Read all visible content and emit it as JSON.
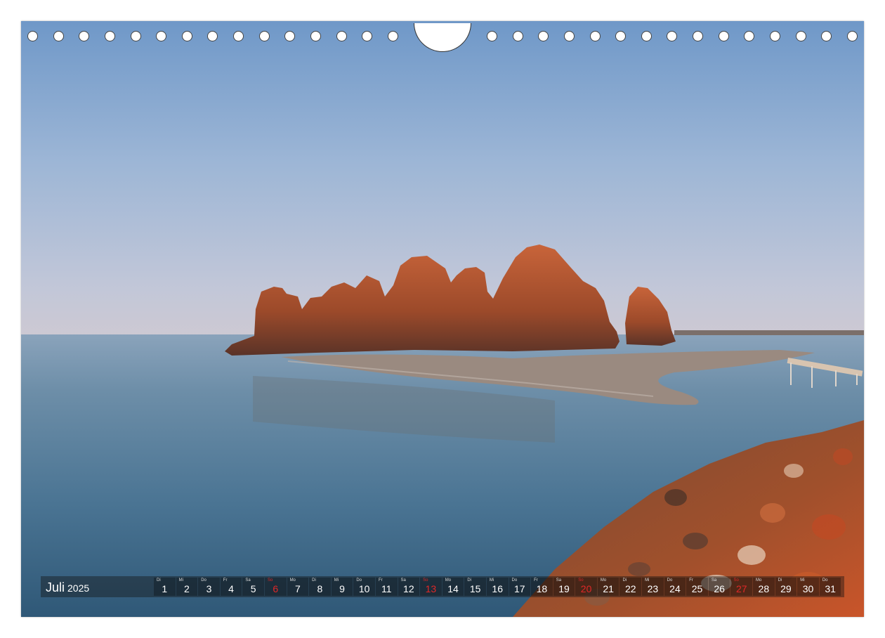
{
  "calendar": {
    "month": "Juli",
    "year": "2025",
    "days": [
      {
        "wd": "Di",
        "d": "1"
      },
      {
        "wd": "Mi",
        "d": "2"
      },
      {
        "wd": "Do",
        "d": "3"
      },
      {
        "wd": "Fr",
        "d": "4"
      },
      {
        "wd": "Sa",
        "d": "5"
      },
      {
        "wd": "So",
        "d": "6",
        "sunday": true
      },
      {
        "wd": "Mo",
        "d": "7"
      },
      {
        "wd": "Di",
        "d": "8"
      },
      {
        "wd": "Mi",
        "d": "9"
      },
      {
        "wd": "Do",
        "d": "10"
      },
      {
        "wd": "Fr",
        "d": "11"
      },
      {
        "wd": "Sa",
        "d": "12"
      },
      {
        "wd": "So",
        "d": "13",
        "sunday": true
      },
      {
        "wd": "Mo",
        "d": "14"
      },
      {
        "wd": "Di",
        "d": "15"
      },
      {
        "wd": "Mi",
        "d": "16"
      },
      {
        "wd": "Do",
        "d": "17"
      },
      {
        "wd": "Fr",
        "d": "18"
      },
      {
        "wd": "Sa",
        "d": "19"
      },
      {
        "wd": "So",
        "d": "20",
        "sunday": true
      },
      {
        "wd": "Mo",
        "d": "21"
      },
      {
        "wd": "Di",
        "d": "22"
      },
      {
        "wd": "Mi",
        "d": "23"
      },
      {
        "wd": "Do",
        "d": "24"
      },
      {
        "wd": "Fr",
        "d": "25"
      },
      {
        "wd": "Sa",
        "d": "26"
      },
      {
        "wd": "So",
        "d": "27",
        "sunday": true
      },
      {
        "wd": "Mo",
        "d": "28"
      },
      {
        "wd": "Di",
        "d": "29"
      },
      {
        "wd": "Mi",
        "d": "30"
      },
      {
        "wd": "Do",
        "d": "31"
      }
    ]
  },
  "colors": {
    "sunday": "#e02828",
    "sky_top": "#6f98c8",
    "sky_horizon": "#c4c8d8",
    "water": "#3f6a8c",
    "rock": "#b2552e"
  }
}
